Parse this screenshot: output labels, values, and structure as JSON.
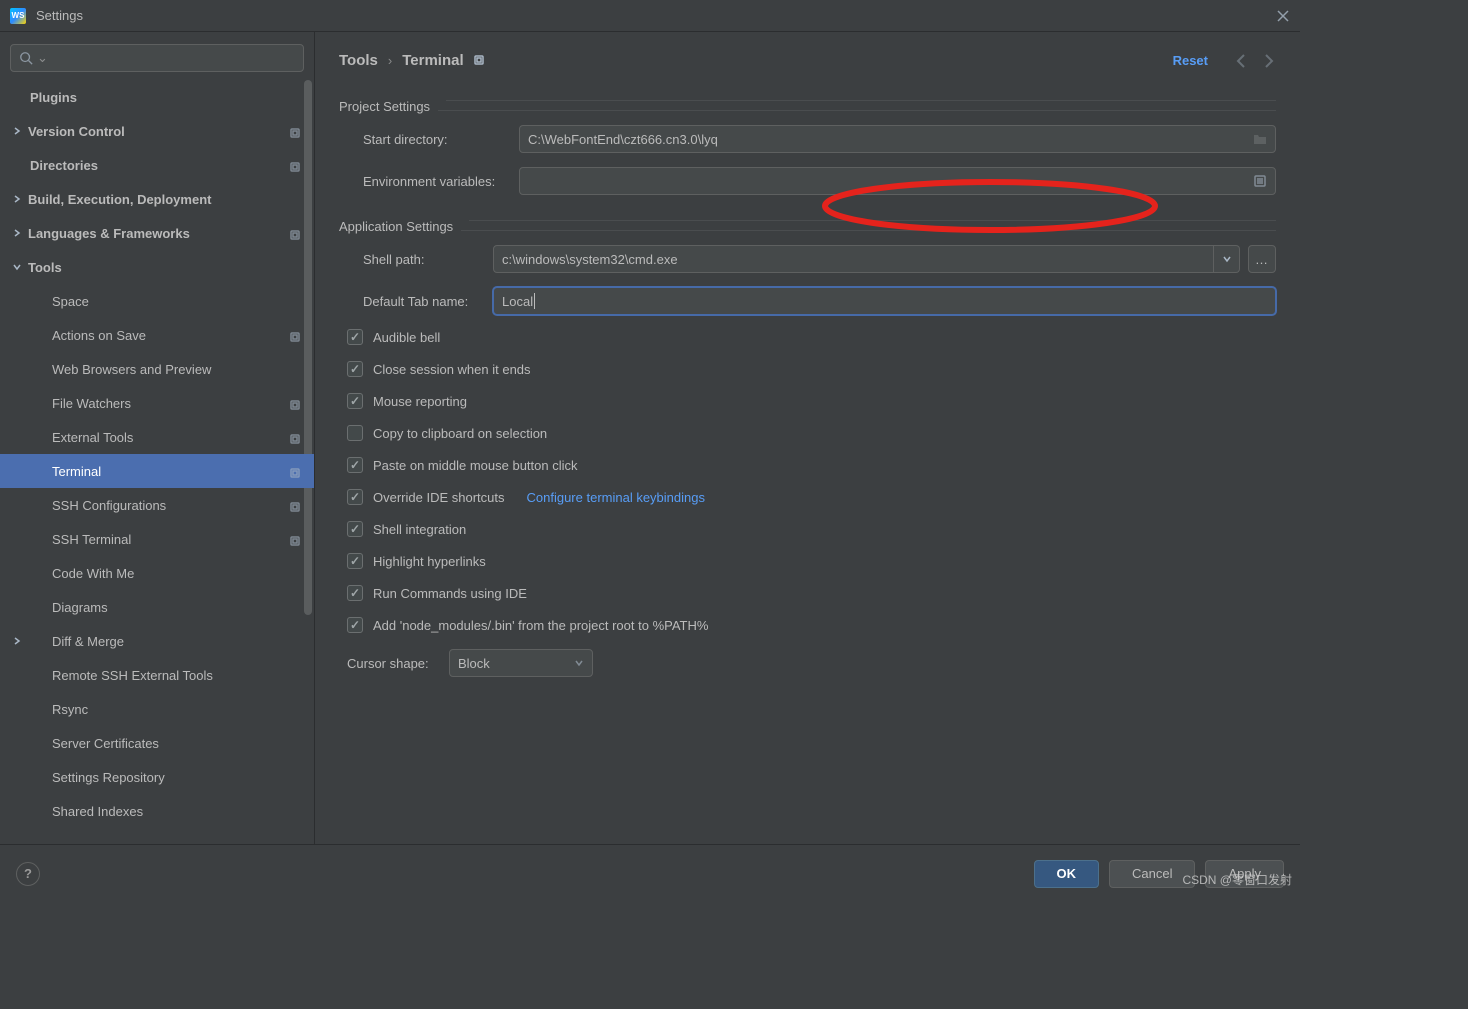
{
  "window": {
    "title": "Settings"
  },
  "sidebar": {
    "items": [
      {
        "label": "Plugins",
        "type": "top"
      },
      {
        "label": "Version Control",
        "type": "expandable",
        "marker": true
      },
      {
        "label": "Directories",
        "type": "top",
        "marker": true
      },
      {
        "label": "Build, Execution, Deployment",
        "type": "expandable"
      },
      {
        "label": "Languages & Frameworks",
        "type": "expandable",
        "marker": true
      },
      {
        "label": "Tools",
        "type": "expandable",
        "expanded": true
      },
      {
        "label": "Space",
        "type": "child"
      },
      {
        "label": "Actions on Save",
        "type": "child",
        "marker": true
      },
      {
        "label": "Web Browsers and Preview",
        "type": "child"
      },
      {
        "label": "File Watchers",
        "type": "child",
        "marker": true
      },
      {
        "label": "External Tools",
        "type": "child",
        "marker": true
      },
      {
        "label": "Terminal",
        "type": "child",
        "marker": true,
        "selected": true
      },
      {
        "label": "SSH Configurations",
        "type": "child",
        "marker": true
      },
      {
        "label": "SSH Terminal",
        "type": "child",
        "marker": true
      },
      {
        "label": "Code With Me",
        "type": "child"
      },
      {
        "label": "Diagrams",
        "type": "child"
      },
      {
        "label": "Diff & Merge",
        "type": "expandable-child"
      },
      {
        "label": "Remote SSH External Tools",
        "type": "child"
      },
      {
        "label": "Rsync",
        "type": "child"
      },
      {
        "label": "Server Certificates",
        "type": "child"
      },
      {
        "label": "Settings Repository",
        "type": "child"
      },
      {
        "label": "Shared Indexes",
        "type": "child"
      }
    ]
  },
  "breadcrumb": {
    "parent": "Tools",
    "current": "Terminal",
    "reset": "Reset"
  },
  "sections": {
    "project": {
      "title": "Project Settings",
      "start_dir_label": "Start directory:",
      "start_dir_value": "C:\\WebFontEnd\\czt666.cn3.0\\lyq",
      "env_label": "Environment variables:",
      "env_value": ""
    },
    "app": {
      "title": "Application Settings",
      "shell_label": "Shell path:",
      "shell_value": "c:\\windows\\system32\\cmd.exe",
      "tab_label": "Default Tab name:",
      "tab_value": "Local",
      "checks": [
        {
          "label": "Audible bell",
          "checked": true
        },
        {
          "label": "Close session when it ends",
          "checked": true
        },
        {
          "label": "Mouse reporting",
          "checked": true
        },
        {
          "label": "Copy to clipboard on selection",
          "checked": false
        },
        {
          "label": "Paste on middle mouse button click",
          "checked": true
        },
        {
          "label": "Override IDE shortcuts",
          "checked": true,
          "link": "Configure terminal keybindings"
        },
        {
          "label": "Shell integration",
          "checked": true
        },
        {
          "label": "Highlight hyperlinks",
          "checked": true
        },
        {
          "label": "Run Commands using IDE",
          "checked": true
        },
        {
          "label": "Add 'node_modules/.bin' from the project root to %PATH%",
          "checked": true
        }
      ],
      "cursor_label": "Cursor shape:",
      "cursor_value": "Block"
    }
  },
  "footer": {
    "ok": "OK",
    "cancel": "Cancel",
    "apply": "Apply"
  },
  "watermark": "CSDN @零窗口发射"
}
